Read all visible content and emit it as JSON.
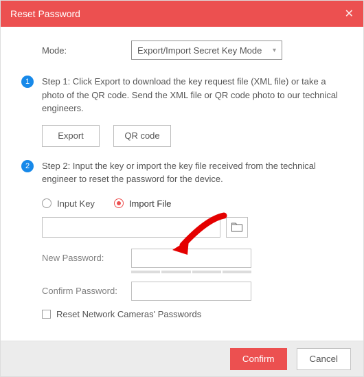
{
  "dialog": {
    "title": "Reset Password"
  },
  "mode": {
    "label": "Mode:",
    "selected": "Export/Import Secret Key Mode"
  },
  "step1": {
    "num": "1",
    "text": "Step 1: Click Export to download the key request file (XML file) or take a photo of the QR code. Send the XML file or QR code photo to our technical engineers.",
    "export_label": "Export",
    "qrcode_label": "QR code"
  },
  "step2": {
    "num": "2",
    "text": "Step 2: Input the key or import the key file received from the technical engineer to reset the password for the device.",
    "radio_input_key": "Input Key",
    "radio_import_file": "Import File",
    "file_path": "",
    "new_password_label": "New Password:",
    "new_password_value": "",
    "confirm_password_label": "Confirm Password:",
    "confirm_password_value": "",
    "reset_cams_label": "Reset Network Cameras' Passwords"
  },
  "footer": {
    "confirm": "Confirm",
    "cancel": "Cancel"
  }
}
